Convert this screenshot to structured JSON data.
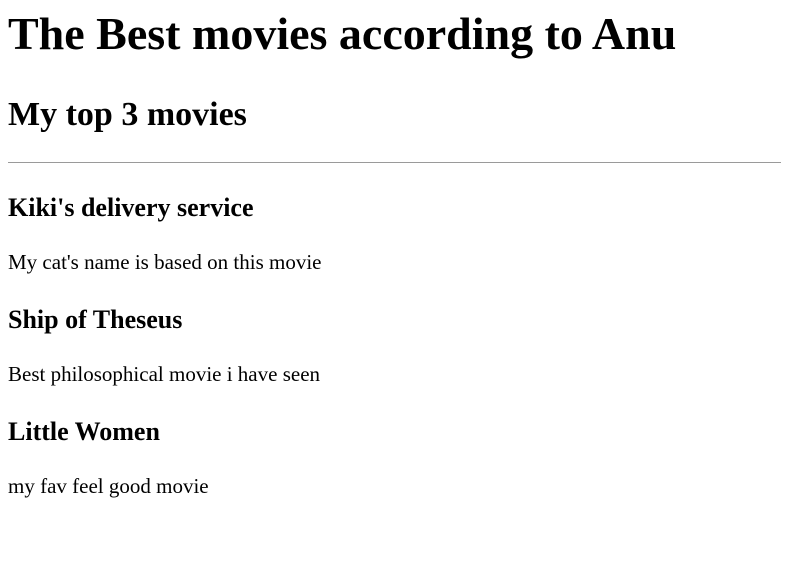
{
  "page": {
    "title": "The Best movies according to Anu",
    "subtitle": "My top 3 movies"
  },
  "movies": [
    {
      "title": "Kiki's delivery service",
      "description": "My cat's name is based on this movie"
    },
    {
      "title": "Ship of Theseus",
      "description": "Best philosophical movie i have seen"
    },
    {
      "title": "Little Women",
      "description": "my fav feel good movie"
    }
  ]
}
